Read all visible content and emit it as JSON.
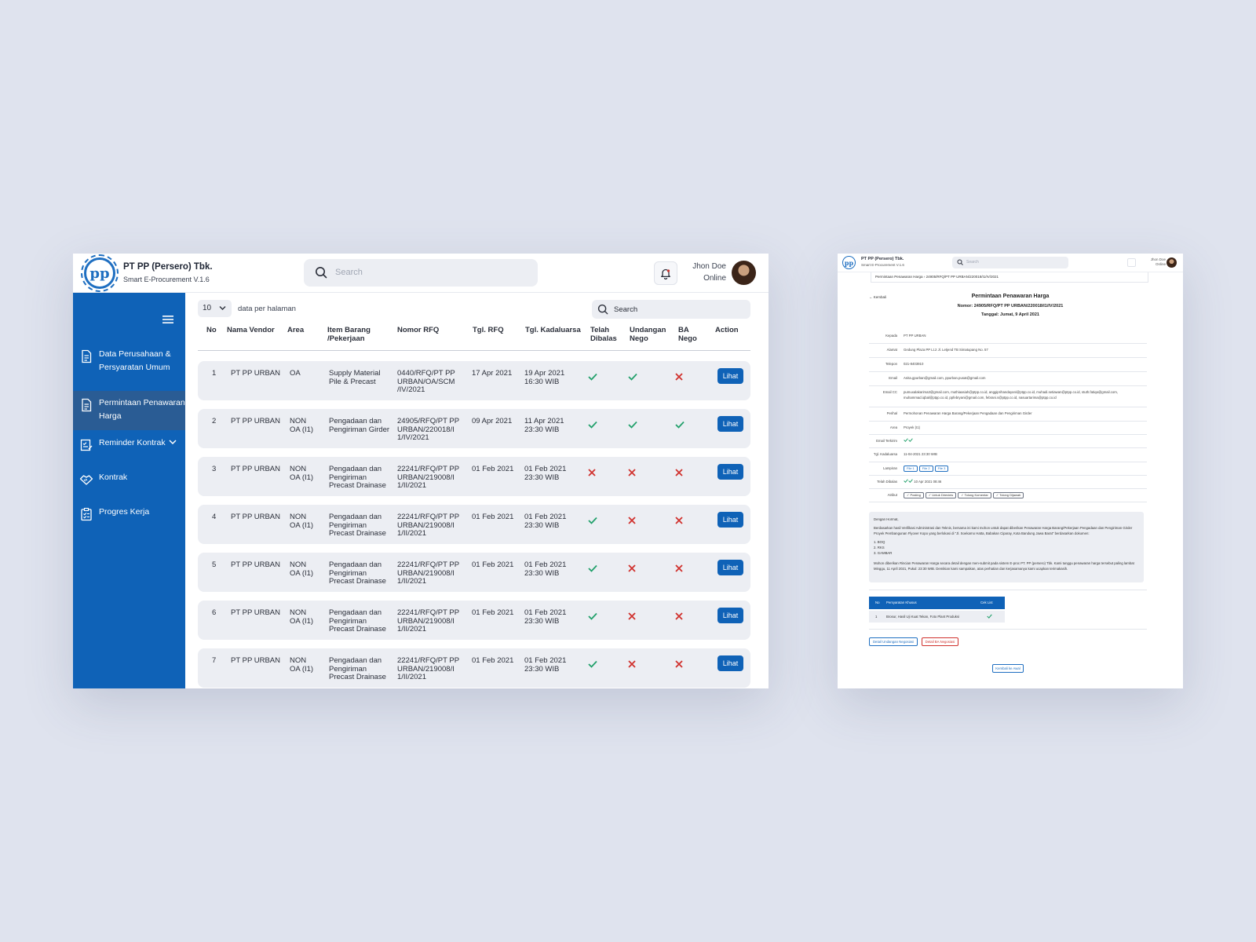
{
  "app": {
    "company": "PT PP (Persero) Tbk.",
    "product": "Smart E-Procurement V.1.6",
    "logo_text": "pp",
    "search_placeholder": "Search",
    "user_name": "Jhon Doe",
    "user_status": "Online",
    "accent": "#0f62b7"
  },
  "sidebar": {
    "items": [
      {
        "label": "Data Perusahaan & Persyaratan Umum",
        "icon": "document-icon"
      },
      {
        "label": "Permintaan Penawaran Harga",
        "icon": "document-edit-icon"
      },
      {
        "label": "Reminder Kontrak",
        "icon": "checklist-icon"
      },
      {
        "label": "Kontrak",
        "icon": "handshake-icon"
      },
      {
        "label": "Progres Kerja",
        "icon": "clipboard-icon"
      }
    ]
  },
  "table": {
    "per_page_value": "10",
    "per_page_label": "data per halaman",
    "search_label": "Search",
    "headers": [
      "No",
      "Nama Vendor",
      "Area",
      "Item Barang /Pekerjaan",
      "Nomor RFQ",
      "Tgl. RFQ",
      "Tgl. Kadaluarsa",
      "Telah Dibalas",
      "Undangan Nego",
      "BA Nego",
      "Action"
    ],
    "action_label": "Lihat",
    "rows": [
      {
        "no": "1",
        "vendor": "PT PP URBAN",
        "area": "OA",
        "item": "Supply Material Pile & Precast",
        "rfq": "0440/RFQ/PT PP URBAN/OA/SCM /IV/2021",
        "tgl_rfq": "17 Apr 2021",
        "kadaluarsa": "19 Apr 2021 16:30 WIB",
        "dibalas": true,
        "undangan": true,
        "ba": false
      },
      {
        "no": "2",
        "vendor": "PT PP URBAN",
        "area": "NON OA (I1)",
        "item": "Pengadaan dan Pengiriman Girder",
        "rfq": "24905/RFQ/PT PP URBAN/220018/I 1/IV/2021",
        "tgl_rfq": "09 Apr 2021",
        "kadaluarsa": "11 Apr 2021 23:30 WIB",
        "dibalas": true,
        "undangan": true,
        "ba": true
      },
      {
        "no": "3",
        "vendor": "PT PP URBAN",
        "area": "NON OA (I1)",
        "item": "Pengadaan dan Pengiriman Precast Drainase",
        "rfq": "22241/RFQ/PT PP URBAN/219008/I 1/II/2021",
        "tgl_rfq": "01 Feb 2021",
        "kadaluarsa": "01 Feb 2021 23:30 WIB",
        "dibalas": false,
        "undangan": false,
        "ba": false
      },
      {
        "no": "4",
        "vendor": "PT PP URBAN",
        "area": "NON OA (I1)",
        "item": "Pengadaan dan Pengiriman Precast Drainase",
        "rfq": "22241/RFQ/PT PP URBAN/219008/I 1/II/2021",
        "tgl_rfq": "01 Feb 2021",
        "kadaluarsa": "01 Feb 2021 23:30 WIB",
        "dibalas": true,
        "undangan": false,
        "ba": false
      },
      {
        "no": "5",
        "vendor": "PT PP URBAN",
        "area": "NON OA (I1)",
        "item": "Pengadaan dan Pengiriman Precast Drainase",
        "rfq": "22241/RFQ/PT PP URBAN/219008/I 1/II/2021",
        "tgl_rfq": "01 Feb 2021",
        "kadaluarsa": "01 Feb 2021 23:30 WIB",
        "dibalas": true,
        "undangan": false,
        "ba": false
      },
      {
        "no": "6",
        "vendor": "PT PP URBAN",
        "area": "NON OA (I1)",
        "item": "Pengadaan dan Pengiriman Precast Drainase",
        "rfq": "22241/RFQ/PT PP URBAN/219008/I 1/II/2021",
        "tgl_rfq": "01 Feb 2021",
        "kadaluarsa": "01 Feb 2021 23:30 WIB",
        "dibalas": true,
        "undangan": false,
        "ba": false
      },
      {
        "no": "7",
        "vendor": "PT PP URBAN",
        "area": "NON OA (I1)",
        "item": "Pengadaan dan Pengiriman Precast Drainase",
        "rfq": "22241/RFQ/PT PP URBAN/219008/I 1/II/2021",
        "tgl_rfq": "01 Feb 2021",
        "kadaluarsa": "01 Feb 2021 23:30 WIB",
        "dibalas": true,
        "undangan": false,
        "ba": false
      }
    ]
  },
  "detail": {
    "breadcrumb_parent": "Permintaan Penawaran Harga",
    "breadcrumb_current": "24905/RFQ/PT PP URBAN/220018/I1/IV/2021",
    "back_label": "Kembali",
    "title": "Permintaan Penawaran Harga",
    "nomor": "Nomor: 24905/RFQ/PT PP URBAN/220018/I1/IV/2021",
    "tanggal": "Tanggal: Jumat, 9 April 2021",
    "fields": [
      {
        "label": "Kepada",
        "value": "PT PP URBAN"
      },
      {
        "label": "Alamat",
        "value": "Gedung Plaza PP Lt.2 Jl. Letjend TB Simatupang No. 57"
      },
      {
        "label": "Telepon",
        "value": "021-8403910"
      },
      {
        "label": "Email",
        "value": "Anita.gpurban@gmail.com, ppurban.pusat@gmail.com"
      },
      {
        "label": "Email CC",
        "value": "pumuxalakarima3@gmail.com, muthiaasiah@ptpp.co.id, anggiprihandayani@ptpp.co.id, muhadi.setiawan@ptpp.co.id, stuth.fatiqa@gmail.com, muhammad.iqbal@ptpp.co.id, ppfebryani@gmail.com, febrani.s@ptpp.co.id, nasuartarima@ptpp.co.id"
      },
      {
        "label": "Perihal",
        "value": "Permohonan Penawaran Harga Barang/Pekerjaan Pengadaan dan Pengiriman Girder"
      },
      {
        "label": "Area",
        "value": "Proyek (I1)"
      },
      {
        "label": "Email Terkirim",
        "value": ""
      },
      {
        "label": "Tgl. Kadaluarsa",
        "value": "11-04-2021 23:30 WIB"
      },
      {
        "label": "Lampiran",
        "value": ""
      },
      {
        "label": "Telah Dibalas",
        "value": "10 Apr 2021 08:46"
      },
      {
        "label": "Atribut",
        "value": ""
      }
    ],
    "lampiran": [
      "File 1",
      "File 2",
      "File 3"
    ],
    "atribut": [
      "Posting",
      "Untuk Direview",
      "Tolong Komentar",
      "Tolong Dijawab"
    ],
    "letter": {
      "greeting": "Dengan Hormat,",
      "body1": "Berdasarkan hasil Verifikasi Administrasi dan Teknis, bersama ini kami mohon untuk dapat diberikan Penawaran Harga Barang/Pekerjaan Pengadaan dan Pengiriman Girder Proyek Pembangunan Flyover Kopo yang berlokasi di \"Jl. Soekarno Hatta, Babakan Ciparay, Kota Bandung Jawa Barat\" berdasarkan dokumen:",
      "items": [
        "1. BOQ",
        "2. RKS",
        "3. GAMBAR"
      ],
      "body2": "Mohon diberikan Rincian Penawaran Harga secara detail dengan men-submit pada sistem E-proc PT. PP (persero) Tbk. Kami tunggu penawaran harga tersebut paling lambat Minggu, 11 April 2021, Pukul: 23:30 WIB. Demikian kami sampaikan, atas perhatian dan kerjasamanya kami ucapkan terimakasih."
    },
    "req_table": {
      "headers": [
        "No",
        "Persyaratan Khusus",
        "Cek List"
      ],
      "row": {
        "no": "1",
        "text": "Brosur, Hasil Uji Kuat Tekan, Foto Plant Produksi"
      }
    },
    "btn_detail": "Detail Undangan Negosiasi",
    "btn_ba": "Detail BA Negosiasi",
    "btn_back": "Kembali ke Awal"
  }
}
